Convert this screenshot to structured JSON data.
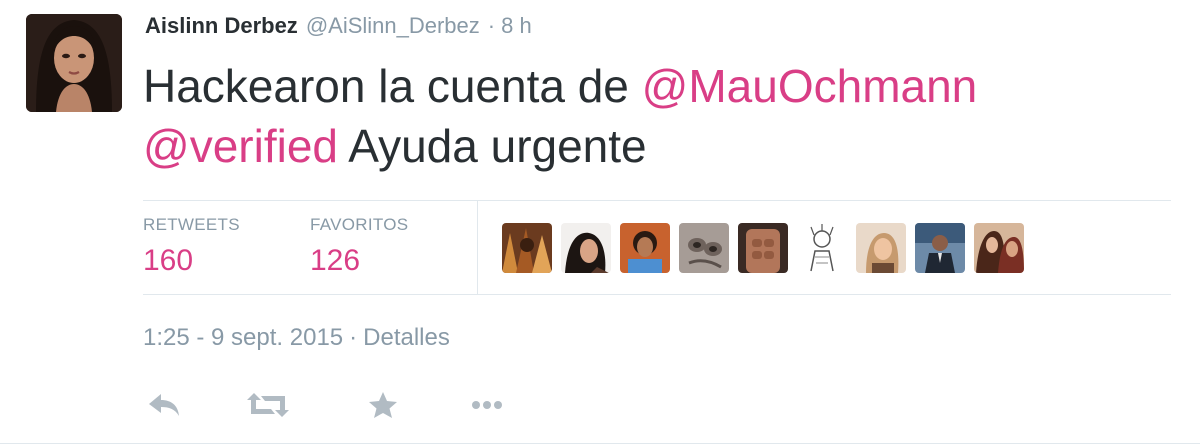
{
  "tweet": {
    "author": {
      "full_name": "Aislinn Derbez",
      "username": "@AiSlinn_Derbez",
      "separator": "·",
      "time": "8 h",
      "avatar": "avatar"
    },
    "text": {
      "part1": "Hackearon la cuenta de ",
      "mention1": "@MauOchmann",
      "mention2": "@verified",
      "part2": " Ayuda urgente"
    },
    "stats": {
      "retweets_label": "RETWEETS",
      "retweets_value": "160",
      "favorites_label": "FAVORITOS",
      "favorites_value": "126"
    },
    "favoriters_count_shown": 9,
    "meta": {
      "timestamp": "1:25 - 9 sept. 2015",
      "separator": "·",
      "details_link": "Detalles"
    },
    "actions": [
      {
        "name": "reply-icon"
      },
      {
        "name": "retweet-icon"
      },
      {
        "name": "favorite-icon"
      },
      {
        "name": "more-icon"
      }
    ],
    "colors": {
      "mention": "#d93e86",
      "stat_value": "#d93e86",
      "muted": "#8899a6",
      "text": "#292f33",
      "divider": "#e1e8ed",
      "icon": "#b1bbc3"
    }
  }
}
